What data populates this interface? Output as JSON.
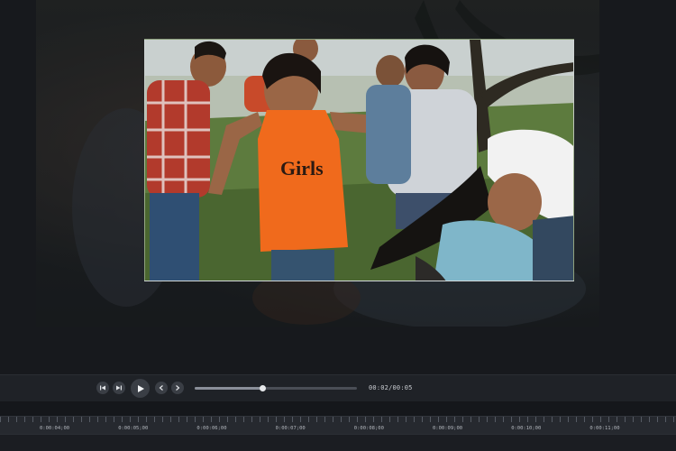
{
  "player": {
    "timecode": "00:02/00:05",
    "progress_fraction": 0.42
  },
  "photo": {
    "shirt_text": "Girls",
    "description_icons": [
      "previous-frame-icon",
      "next-frame-icon",
      "play-icon",
      "step-back-icon",
      "step-forward-icon"
    ]
  },
  "timeline": {
    "labels": [
      "0:00:04;00",
      "0:00:05;00",
      "0:00:06;00",
      "0:00:07;00",
      "0:00:08;00",
      "0:00:09;00",
      "0:00:10;00",
      "0:00:11;00"
    ]
  },
  "colors": {
    "background": "#15171b",
    "control_bar": "#1f2227",
    "ruler": "#26292f",
    "accent_orange": "#f06a1c"
  }
}
